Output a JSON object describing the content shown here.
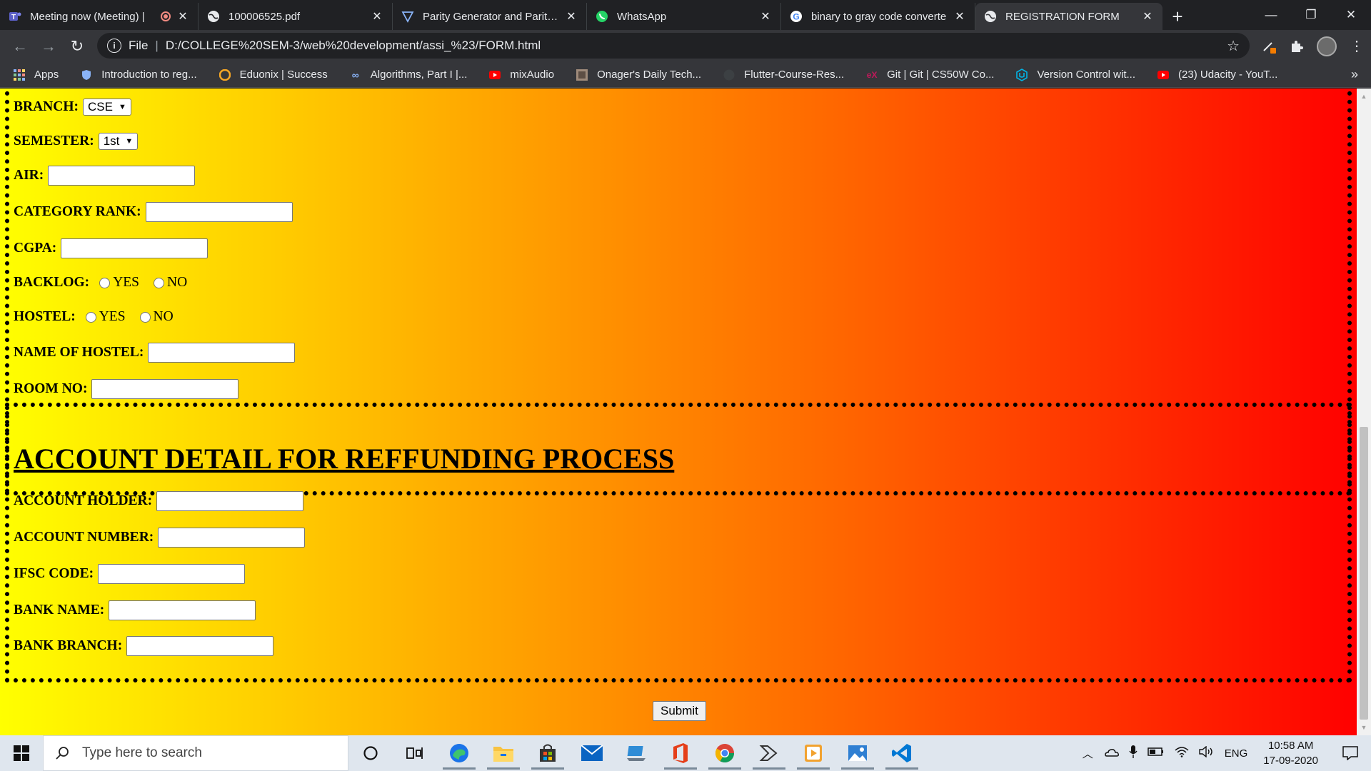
{
  "browser": {
    "tabs": [
      {
        "title": "Meeting now (Meeting) |",
        "icon": "teams-icon",
        "recording": true
      },
      {
        "title": "100006525.pdf",
        "icon": "globe-icon"
      },
      {
        "title": "Parity Generator and Parity C",
        "icon": "triangle-icon"
      },
      {
        "title": "WhatsApp",
        "icon": "whatsapp-icon"
      },
      {
        "title": "binary to gray code converte",
        "icon": "google-icon"
      },
      {
        "title": "REGISTRATION FORM",
        "icon": "globe-icon",
        "active": true
      }
    ],
    "address": {
      "scheme": "File",
      "url": "D:/COLLEGE%20SEM-3/web%20development/assi_%23/FORM.html"
    },
    "bookmarks": [
      {
        "label": "Apps",
        "icon": "apps-grid-icon"
      },
      {
        "label": "Introduction to reg...",
        "icon": "shield-icon"
      },
      {
        "label": "Eduonix | Success",
        "icon": "eduonix-icon"
      },
      {
        "label": "Algorithms, Part I |...",
        "icon": "coursera-icon"
      },
      {
        "label": "mixAudio",
        "icon": "youtube-icon"
      },
      {
        "label": "Onager's Daily Tech...",
        "icon": "image-icon"
      },
      {
        "label": "Flutter-Course-Res...",
        "icon": "github-icon"
      },
      {
        "label": "Git | Git | CS50W Co...",
        "icon": "edx-icon"
      },
      {
        "label": "Version Control wit...",
        "icon": "udacity-icon"
      },
      {
        "label": "(23) Udacity - YouT...",
        "icon": "youtube-icon"
      }
    ],
    "bookmarks_more": "»"
  },
  "form": {
    "branch": {
      "label": "BRANCH:",
      "value": "CSE"
    },
    "semester": {
      "label": "SEMESTER:",
      "value": "1st"
    },
    "air": {
      "label": "AIR:"
    },
    "category_rank": {
      "label": "CATEGORY RANK:"
    },
    "cgpa": {
      "label": "CGPA:"
    },
    "backlog": {
      "label": "BACKLOG:",
      "options": [
        "YES",
        "NO"
      ]
    },
    "hostel": {
      "label": "HOSTEL:",
      "options": [
        "YES",
        "NO"
      ]
    },
    "hostel_name": {
      "label": "NAME OF HOSTEL:"
    },
    "room_no": {
      "label": "ROOM NO:"
    },
    "account_heading": "ACCOUNT DETAIL FOR REFFUNDING PROCESS",
    "account_holder": {
      "label": "ACCOUNT HOLDER:"
    },
    "account_number": {
      "label": "ACCOUNT NUMBER:"
    },
    "ifsc": {
      "label": "IFSC CODE:"
    },
    "bank_name": {
      "label": "BANK NAME:"
    },
    "bank_branch": {
      "label": "BANK BRANCH:"
    },
    "submit_label": "Submit"
  },
  "colors": {
    "gradient_start": "#ffff00",
    "gradient_end": "#ff0000"
  },
  "taskbar": {
    "search_placeholder": "Type here to search",
    "apps": [
      "cortana-icon",
      "task-view-icon",
      "edge-icon",
      "file-explorer-icon",
      "store-icon",
      "mail-icon",
      "laptop-icon",
      "office-icon",
      "chrome-icon",
      "dev-app-icon",
      "media-player-icon",
      "photos-icon",
      "vscode-icon"
    ],
    "tray_language": "ENG",
    "time": "10:58 AM",
    "date": "17-09-2020"
  }
}
